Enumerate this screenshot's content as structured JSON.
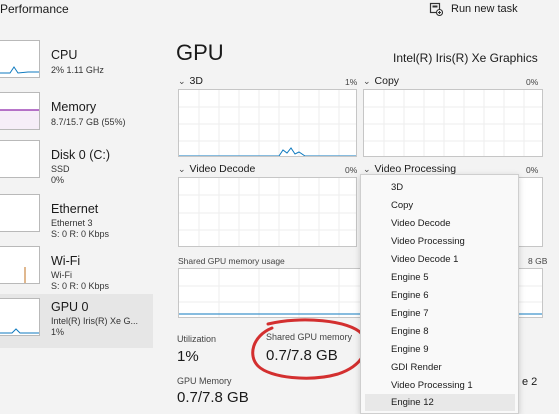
{
  "header": {
    "title": "Performance",
    "run_task_label": "Run new task"
  },
  "sidebar": {
    "items": [
      {
        "title": "CPU",
        "sub1": "2% 1.11 GHz",
        "sub2": "",
        "sub3": "",
        "color": "#0f7abf"
      },
      {
        "title": "Memory",
        "sub1": "8.7/15.7 GB (55%)",
        "sub2": "",
        "sub3": "",
        "color": "#8e24aa"
      },
      {
        "title": "Disk 0 (C:)",
        "sub1": "SSD",
        "sub2": "0%",
        "sub3": "",
        "color": "#2e7d32"
      },
      {
        "title": "Ethernet",
        "sub1": "Ethernet 3",
        "sub2": "S: 0 R: 0 Kbps",
        "sub3": "",
        "color": "#c2711f"
      },
      {
        "title": "Wi-Fi",
        "sub1": "Wi-Fi",
        "sub2": "S: 0 R: 0 Kbps",
        "sub3": "",
        "color": "#c2711f"
      },
      {
        "title": "GPU 0",
        "sub1": "Intel(R) Iris(R) Xe G...",
        "sub2": "1%",
        "sub3": "",
        "color": "#0f7abf"
      }
    ]
  },
  "main": {
    "title": "GPU",
    "gpu_name": "Intel(R) Iris(R) Xe Graphics",
    "engines": [
      {
        "label": "3D",
        "percent": "1%"
      },
      {
        "label": "Copy",
        "percent": "0%"
      },
      {
        "label": "Video Decode",
        "percent": "0%"
      },
      {
        "label": "Video Processing",
        "percent": "0%"
      }
    ],
    "shared_usage_label": "Shared GPU memory usage",
    "shared_max_partial": "8 GB",
    "stats": {
      "utilization_label": "Utilization",
      "utilization_value": "1%",
      "shared_label": "Shared GPU memory",
      "shared_value": "0.7/7.8 GB",
      "gpu_mem_label": "GPU Memory",
      "gpu_mem_value": "0.7/7.8 GB",
      "partial_right": "e 2"
    }
  },
  "dropdown": {
    "items": [
      "3D",
      "Copy",
      "Video Decode",
      "Video Processing",
      "Video Decode 1",
      "Engine 5",
      "Engine 6",
      "Engine 7",
      "Engine 8",
      "Engine 9",
      "GDI Render",
      "Video Processing 1",
      "Engine 12"
    ],
    "selected_index": 12
  },
  "colors": {
    "graph_line": "#0f7abf",
    "annotation": "#d32f2f"
  }
}
